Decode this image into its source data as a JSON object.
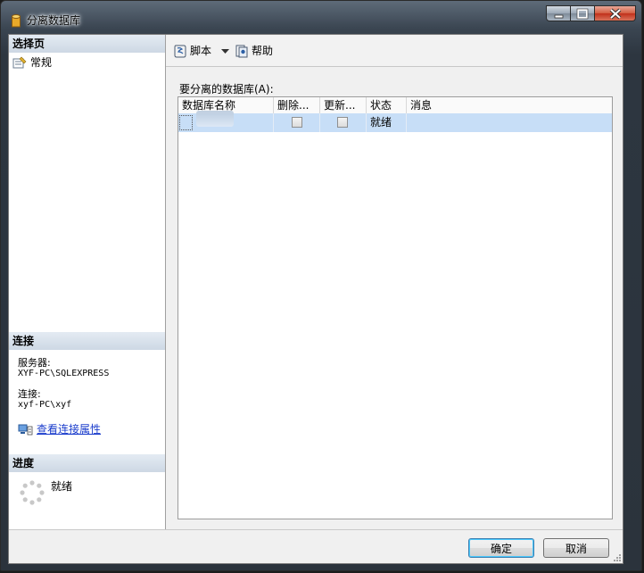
{
  "window": {
    "title": "分离数据库"
  },
  "left_pane": {
    "select_page_header": "选择页",
    "pages": [
      {
        "label": "常规"
      }
    ],
    "connection_header": "连接",
    "server_label": "服务器:",
    "server_value": "XYF-PC\\SQLEXPRESS",
    "connection_label": "连接:",
    "connection_value": "xyf-PC\\xyf",
    "view_connection_properties": "查看连接属性",
    "progress_header": "进度",
    "progress_status": "就绪"
  },
  "toolbar": {
    "script_label": "脚本",
    "help_label": "帮助"
  },
  "main": {
    "section_label": "要分离的数据库(A):",
    "columns": [
      "数据库名称",
      "删除...",
      "更新...",
      "状态",
      "消息"
    ],
    "rows": [
      {
        "name": "",
        "drop": false,
        "update": false,
        "status": "就绪",
        "message": ""
      }
    ]
  },
  "buttons": {
    "ok": "确定",
    "cancel": "取消"
  }
}
